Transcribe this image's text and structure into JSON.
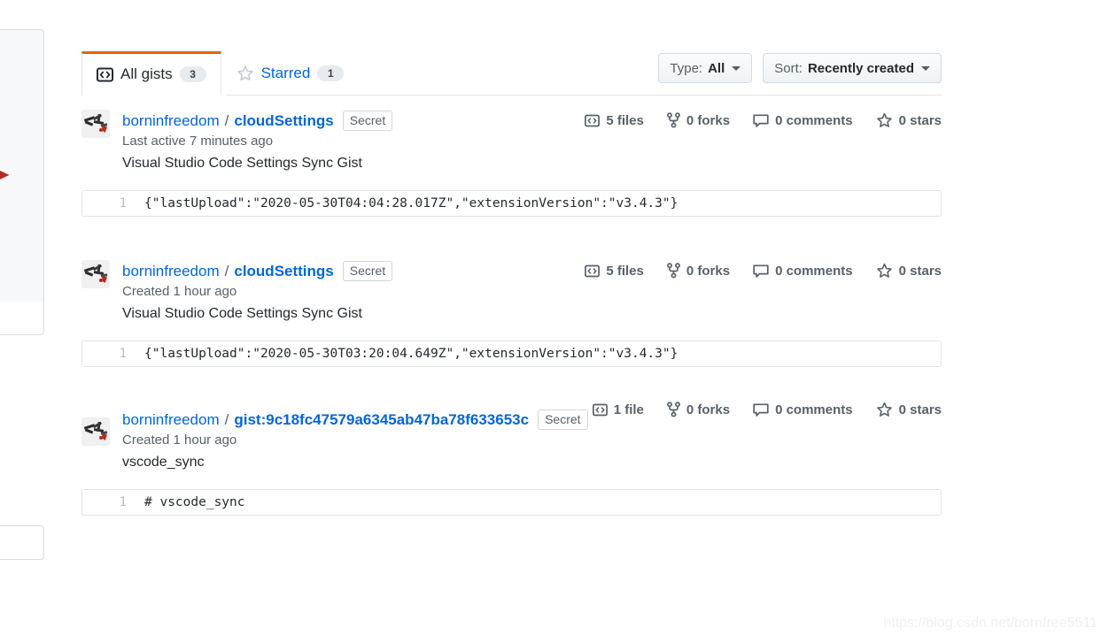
{
  "tabs": [
    {
      "label": "All gists",
      "count": "3",
      "icon": "code-icon",
      "selected": true
    },
    {
      "label": "Starred",
      "count": "1",
      "icon": "star-icon",
      "selected": false
    }
  ],
  "filters": {
    "type": {
      "prefix": "Type:",
      "value": "All",
      "caret": "chevron-down-icon"
    },
    "sort": {
      "prefix": "Sort:",
      "value": "Recently created",
      "caret": "chevron-down-icon"
    }
  },
  "gists": [
    {
      "owner": "borninfreedom",
      "separator": "/",
      "name": "cloudSettings",
      "visibility": "Secret",
      "timestamp": "Last active 7 minutes ago",
      "description": "Visual Studio Code Settings Sync Gist",
      "stats": {
        "files": "5 files",
        "forks": "0 forks",
        "comments": "0 comments",
        "stars": "0 stars"
      },
      "code": {
        "line_number": "1",
        "content": "{\"lastUpload\":\"2020-05-30T04:04:28.017Z\",\"extensionVersion\":\"v3.4.3\"}"
      }
    },
    {
      "owner": "borninfreedom",
      "separator": "/",
      "name": "cloudSettings",
      "visibility": "Secret",
      "timestamp": "Created 1 hour ago",
      "description": "Visual Studio Code Settings Sync Gist",
      "stats": {
        "files": "5 files",
        "forks": "0 forks",
        "comments": "0 comments",
        "stars": "0 stars"
      },
      "code": {
        "line_number": "1",
        "content": "{\"lastUpload\":\"2020-05-30T03:20:04.649Z\",\"extensionVersion\":\"v3.4.3\"}"
      }
    },
    {
      "owner": "borninfreedom",
      "separator": "/",
      "name": "gist:9c18fc47579a6345ab47ba78f633653c",
      "visibility": "Secret",
      "timestamp": "Created 1 hour ago",
      "description": "vscode_sync",
      "stats": {
        "files": "1 file",
        "forks": "0 forks",
        "comments": "0 comments",
        "stars": "0 stars"
      },
      "code": {
        "line_number": "1",
        "content": "# vscode_sync"
      }
    }
  ],
  "watermark": "https://blog.csdn.net/bornfree5511",
  "colors": {
    "accent_tab": "#e36209",
    "link": "#0366d6",
    "muted": "#586069",
    "border": "#e1e4e8"
  }
}
